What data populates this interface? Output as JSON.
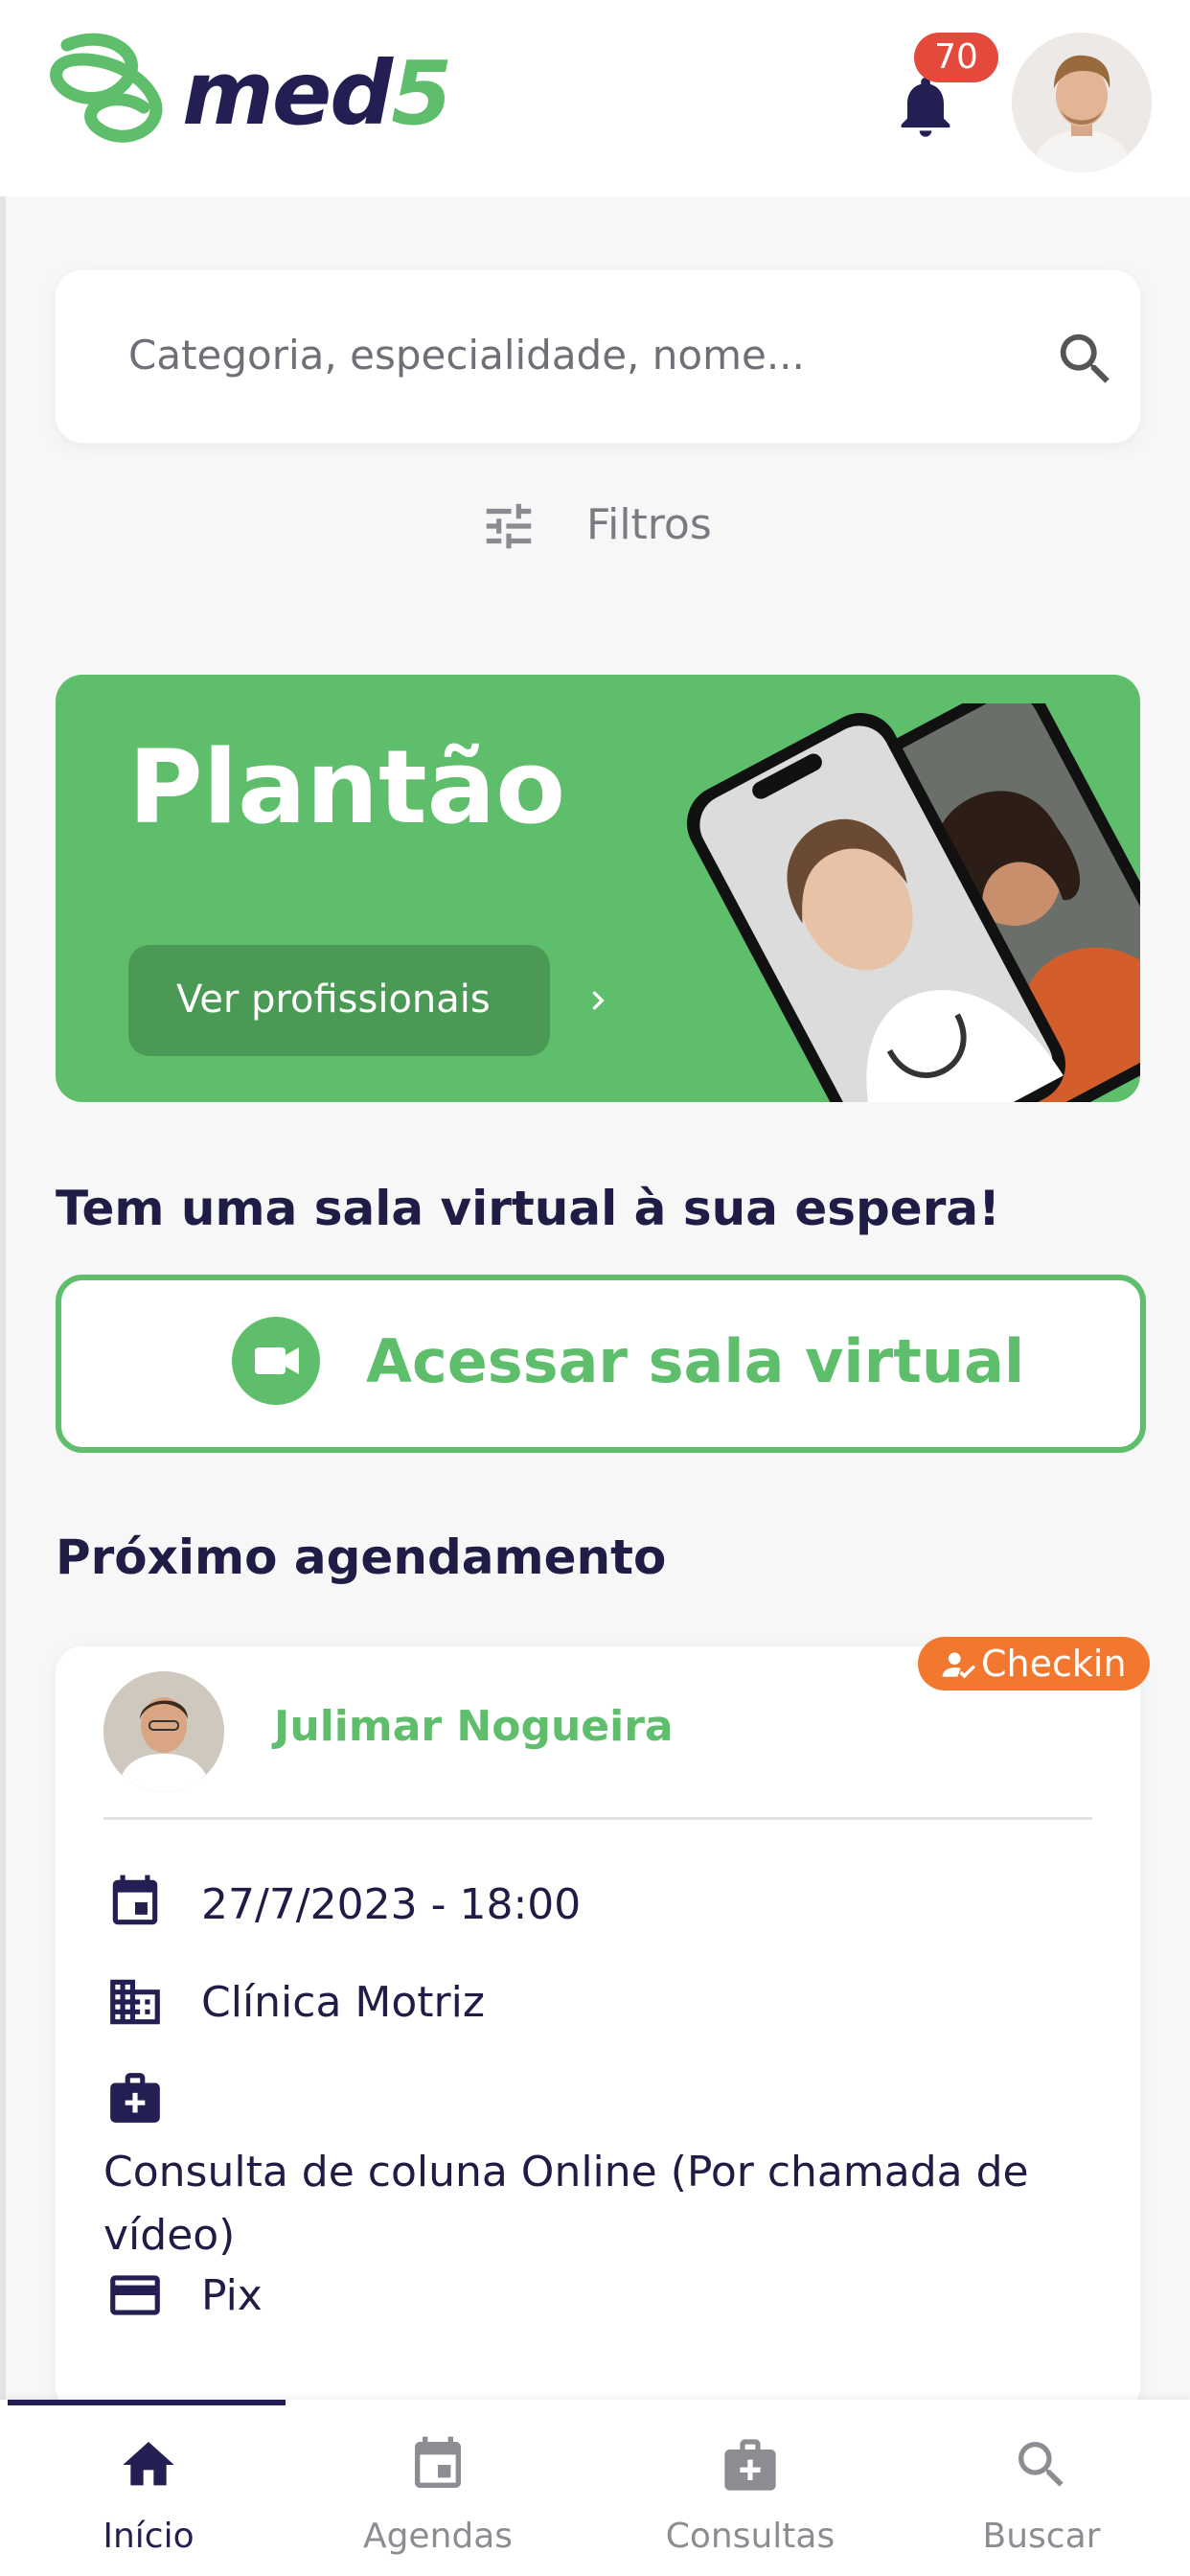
{
  "header": {
    "logo_text": "med",
    "logo_five": "5",
    "notification_count": "70"
  },
  "search": {
    "placeholder": "Categoria, especialidade, nome..."
  },
  "filters": {
    "label": "Filtros"
  },
  "banner": {
    "title": "Plantão",
    "button_label": "Ver profissionais"
  },
  "virtual_room": {
    "heading": "Tem uma sala virtual à sua espera!",
    "button_label": "Acessar sala virtual"
  },
  "next_appointment": {
    "heading": "Próximo agendamento",
    "badge": "Checkin",
    "doctor_name": "Julimar Nogueira",
    "datetime": "27/7/2023 - 18:00",
    "clinic": "Clínica Motriz",
    "service": "Consulta de coluna Online (Por chamada de vídeo)",
    "payment": "Pix"
  },
  "bottom_nav": {
    "items": [
      {
        "label": "Início",
        "icon": "home-icon",
        "active": true
      },
      {
        "label": "Agendas",
        "icon": "calendar-icon",
        "active": false
      },
      {
        "label": "Consultas",
        "icon": "medical-bag-icon",
        "active": false
      },
      {
        "label": "Buscar",
        "icon": "search-icon",
        "active": false
      }
    ]
  },
  "colors": {
    "brand_green": "#5ebe6b",
    "brand_navy": "#231f52",
    "badge_red": "#e34a3c",
    "checkin_orange": "#f2782f"
  }
}
